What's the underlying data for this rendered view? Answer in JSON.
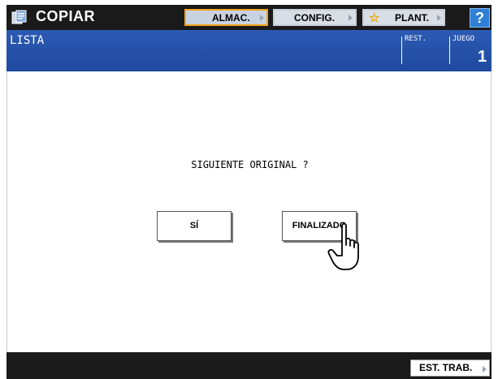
{
  "header": {
    "app_icon": "copier-icon",
    "app_title": "COPIAR",
    "buttons": [
      {
        "label": "ALMAC.",
        "active": true
      },
      {
        "label": "CONFIG.",
        "active": false
      },
      {
        "label": "PLANT.",
        "icon": "star-icon",
        "active": false
      }
    ],
    "help_label": "?"
  },
  "status_bar": {
    "mode_label": "LISTA",
    "rest_label": "REST.",
    "juego_label": "JUEGO",
    "juego_value": "1"
  },
  "dialog": {
    "question": "SIGUIENTE ORIGINAL ?",
    "yes_label": "SÍ",
    "done_label": "FINALIZADO",
    "pointer_icon": "hand-pointer-icon"
  },
  "footer": {
    "job_status_label": "EST. TRAB."
  },
  "colors": {
    "top_bar": "#1a1a1a",
    "status_bar": "#2552a8",
    "active_border": "#f2a21c",
    "help_button": "#2f7fd6"
  }
}
